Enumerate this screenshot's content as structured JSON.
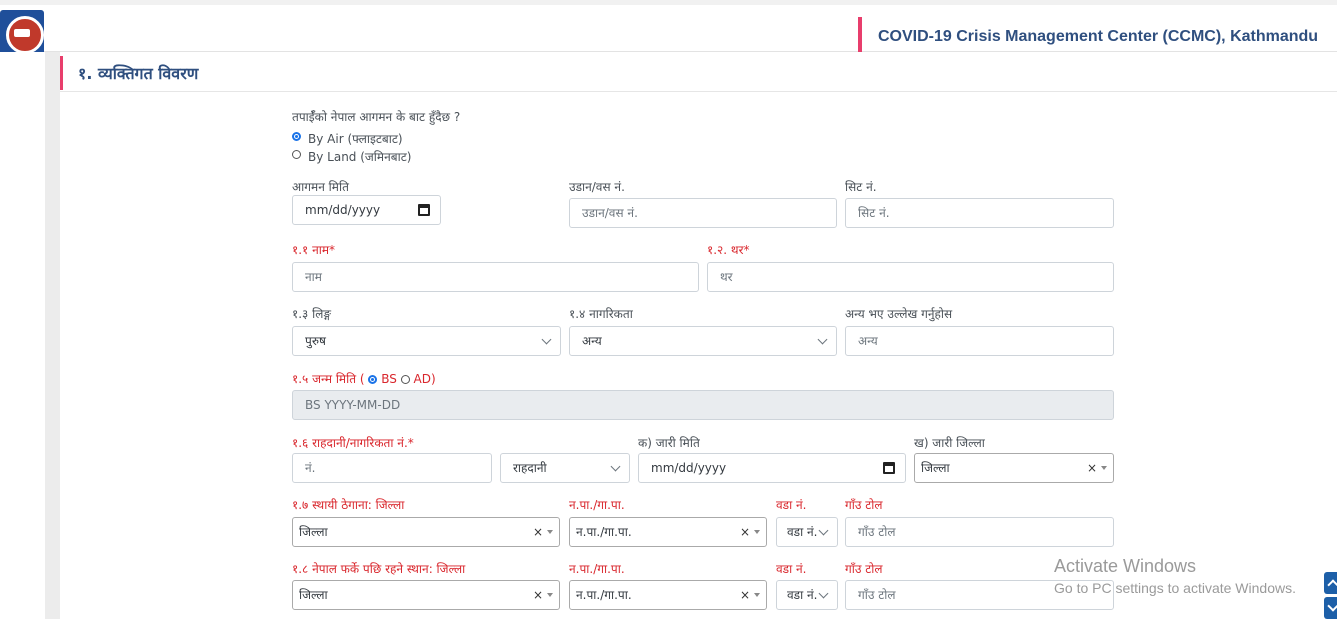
{
  "header": {
    "center_title": "COVID-19 Crisis Management Center (CCMC), Kathmandu"
  },
  "section": {
    "title": "१. व्यक्तिगत विवरण"
  },
  "arrival": {
    "question": "तपाईँको नेपाल आगमन के बाट हुँदैछ ?",
    "options": [
      {
        "label": "By Air (फ्लाइटबाट)",
        "selected": true
      },
      {
        "label": "By Land (जमिनबाट)",
        "selected": false
      }
    ]
  },
  "row1": {
    "arrival_date_label": "आगमन मिति",
    "arrival_date_placeholder": "mm/dd/yyyy",
    "flight_label": "उडान/वस नं.",
    "flight_placeholder": "उडान/वस नं.",
    "seat_label": "सिट नं.",
    "seat_placeholder": "सिट नं."
  },
  "row2": {
    "name_label": "१.१ नाम*",
    "name_placeholder": "नाम",
    "surname_label": "१.२. थर*",
    "surname_placeholder": "थर"
  },
  "row3": {
    "gender_label": "१.३ लिङ्ग",
    "gender_value": "पुरुष",
    "nationality_label": "१.४ नागरिकता",
    "nationality_value": "अन्य",
    "other_label": "अन्य भए उल्लेख गर्नुहोस",
    "other_placeholder": "अन्य"
  },
  "dob": {
    "label_prefix": "१.५ जन्म मिति (",
    "bs": "BS",
    "ad": "AD)",
    "placeholder": "BS YYYY-MM-DD",
    "bs_selected": true
  },
  "row5": {
    "doc_label": "१.६ राहदानी/नागरिकता नं.*",
    "doc_placeholder": "नं.",
    "doc_type_value": "राहदानी",
    "issue_date_label": "क) जारी मिति",
    "issue_date_placeholder": "mm/dd/yyyy",
    "issue_district_label": "ख) जारी जिल्ला",
    "issue_district_value": "जिल्ला"
  },
  "row6": {
    "district_label": "१.७ स्थायी ठेगाना: जिल्ला",
    "district_value": "जिल्ला",
    "municipality_label": "न.पा./गा.पा.",
    "municipality_value": "न.पा./गा.पा.",
    "ward_label": "वडा नं.",
    "ward_value": "वडा नं.",
    "tole_label": "गाँउ टोल",
    "tole_placeholder": "गाँउ टोल"
  },
  "row7": {
    "district_label": "१.८ नेपाल फर्के पछि रहने स्थान: जिल्ला",
    "district_value": "जिल्ला",
    "municipality_label": "न.पा./गा.पा.",
    "municipality_value": "न.पा./गा.पा.",
    "ward_label": "वडा नं.",
    "ward_value": "वडा नं.",
    "tole_label": "गाँउ टोल",
    "tole_placeholder": "गाँउ टोल"
  },
  "watermark": {
    "title": "Activate Windows",
    "subtitle": "Go to PC settings to activate Windows."
  },
  "clear_symbol": "×"
}
